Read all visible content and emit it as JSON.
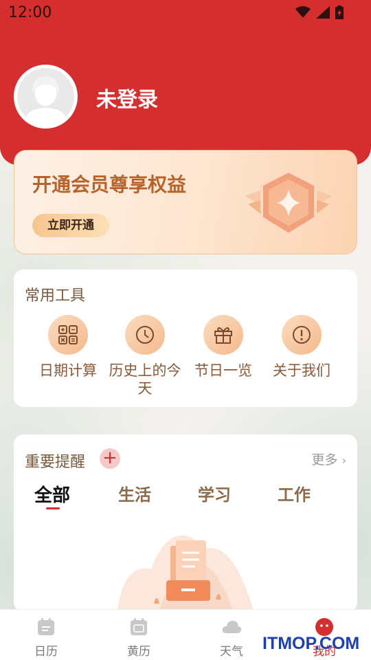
{
  "status_bar": {
    "time": "12:00"
  },
  "profile": {
    "name": "未登录"
  },
  "vip": {
    "title": "开通会员尊享权益",
    "button": "立即开通"
  },
  "tools": {
    "title": "常用工具",
    "items": [
      {
        "label": "日期计算",
        "icon": "calculator-icon"
      },
      {
        "label": "历史上的今天",
        "icon": "clock-icon"
      },
      {
        "label": "节日一览",
        "icon": "gift-icon"
      },
      {
        "label": "关于我们",
        "icon": "info-icon"
      }
    ]
  },
  "reminders": {
    "title": "重要提醒",
    "add": "+",
    "more": "更多",
    "tabs": [
      "全部",
      "生活",
      "学习",
      "工作"
    ],
    "active_tab": "全部"
  },
  "bottom_nav": {
    "items": [
      {
        "label": "日历",
        "icon": "calendar-icon"
      },
      {
        "label": "黄历",
        "icon": "almanac-icon"
      },
      {
        "label": "天气",
        "icon": "cloud-icon"
      },
      {
        "label": "我的",
        "icon": "profile-icon"
      }
    ],
    "active": "我的"
  },
  "watermark": "ITMOP.COM",
  "colors": {
    "brand_red": "#d42e2e",
    "accent_orange": "#f4b98c",
    "text_brown": "#8a5a3a"
  }
}
